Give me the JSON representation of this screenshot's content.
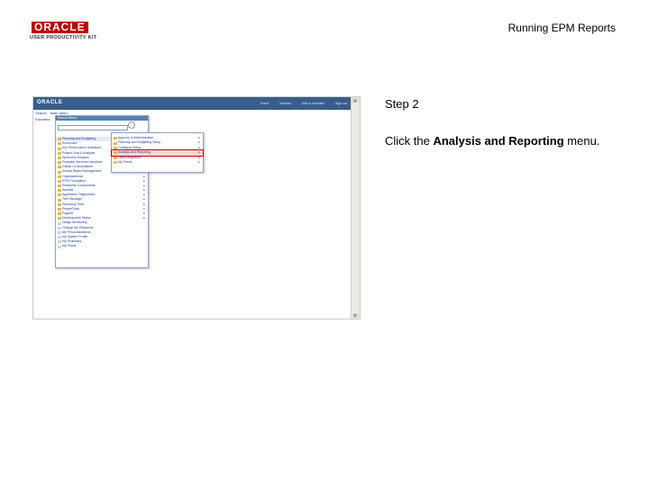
{
  "header": {
    "brand_oracle": "ORACLE",
    "brand_product": "USER PRODUCTIVITY KIT",
    "doc_title": "Running EPM Reports"
  },
  "screenshot": {
    "app_logo": "ORACLE",
    "top_nav": [
      "Home",
      "Worklist",
      "Add to Favorites",
      "Sign out"
    ],
    "sub_nav": [
      "Search",
      "Main Menu"
    ],
    "favorites": "Favorites",
    "search_menu_label": "Search Menu:",
    "main_menu_items": [
      {
        "label": "Planning and Budgeting",
        "icon": "folder-icon",
        "has_submenu": true,
        "selected": true
      },
      {
        "label": "Scorecard",
        "icon": "folder-icon",
        "has_submenu": true
      },
      {
        "label": "Key Performance Indicators",
        "icon": "folder-icon",
        "has_submenu": true
      },
      {
        "label": "Project Cost & Analysis",
        "icon": "folder-icon",
        "has_submenu": true
      },
      {
        "label": "Workforce Analysis",
        "icon": "folder-icon",
        "has_submenu": true
      },
      {
        "label": "Financial Services Industries",
        "icon": "folder-icon",
        "has_submenu": true
      },
      {
        "label": "Global Consolidations",
        "icon": "folder-icon",
        "has_submenu": true
      },
      {
        "label": "Activity Based Management",
        "icon": "folder-icon",
        "has_submenu": true
      },
      {
        "label": "Organizational",
        "icon": "folder-icon",
        "has_submenu": true
      },
      {
        "label": "EPM Foundation",
        "icon": "folder-icon",
        "has_submenu": true
      },
      {
        "label": "Enterprise Components",
        "icon": "folder-icon",
        "has_submenu": true
      },
      {
        "label": "Worklist",
        "icon": "folder-icon",
        "has_submenu": true
      },
      {
        "label": "Application Diagnostics",
        "icon": "folder-icon",
        "has_submenu": true
      },
      {
        "label": "Tree Manager",
        "icon": "folder-icon",
        "has_submenu": true
      },
      {
        "label": "Reporting Tools",
        "icon": "folder-icon",
        "has_submenu": true
      },
      {
        "label": "PeopleTools",
        "icon": "folder-icon",
        "has_submenu": true
      },
      {
        "label": "Pagelet",
        "icon": "folder-icon",
        "has_submenu": true
      },
      {
        "label": "Development Status",
        "icon": "folder-icon",
        "has_submenu": true
      },
      {
        "label": "Usage Monitoring",
        "icon": "document-icon",
        "has_submenu": false
      },
      {
        "label": "Change My Password",
        "icon": "document-icon",
        "has_submenu": false
      },
      {
        "label": "My Personalizations",
        "icon": "document-icon",
        "has_submenu": false
      },
      {
        "label": "My System Profile",
        "icon": "document-icon",
        "has_submenu": false
      },
      {
        "label": "My Dictionary",
        "icon": "document-icon",
        "has_submenu": false
      },
      {
        "label": "My Feeds",
        "icon": "document-icon",
        "has_submenu": false
      }
    ],
    "submenu_items": [
      {
        "label": "Approve & Administration",
        "highlight": false
      },
      {
        "label": "Planning and Budgeting Setup",
        "highlight": false
      },
      {
        "label": "Configure Setup",
        "highlight": false
      },
      {
        "label": "Analysis and Reporting",
        "highlight": true
      },
      {
        "label": "Data Integration",
        "highlight": false
      },
      {
        "label": "My Feeds",
        "highlight": false
      }
    ]
  },
  "instruction": {
    "step": "Step 2",
    "prefix": "Click the ",
    "target": "Analysis and Reporting",
    "suffix": " menu."
  },
  "colors": {
    "highlight_red": "#d00000",
    "app_header_blue": "#3a5e8c",
    "brand_red": "#c00000"
  }
}
